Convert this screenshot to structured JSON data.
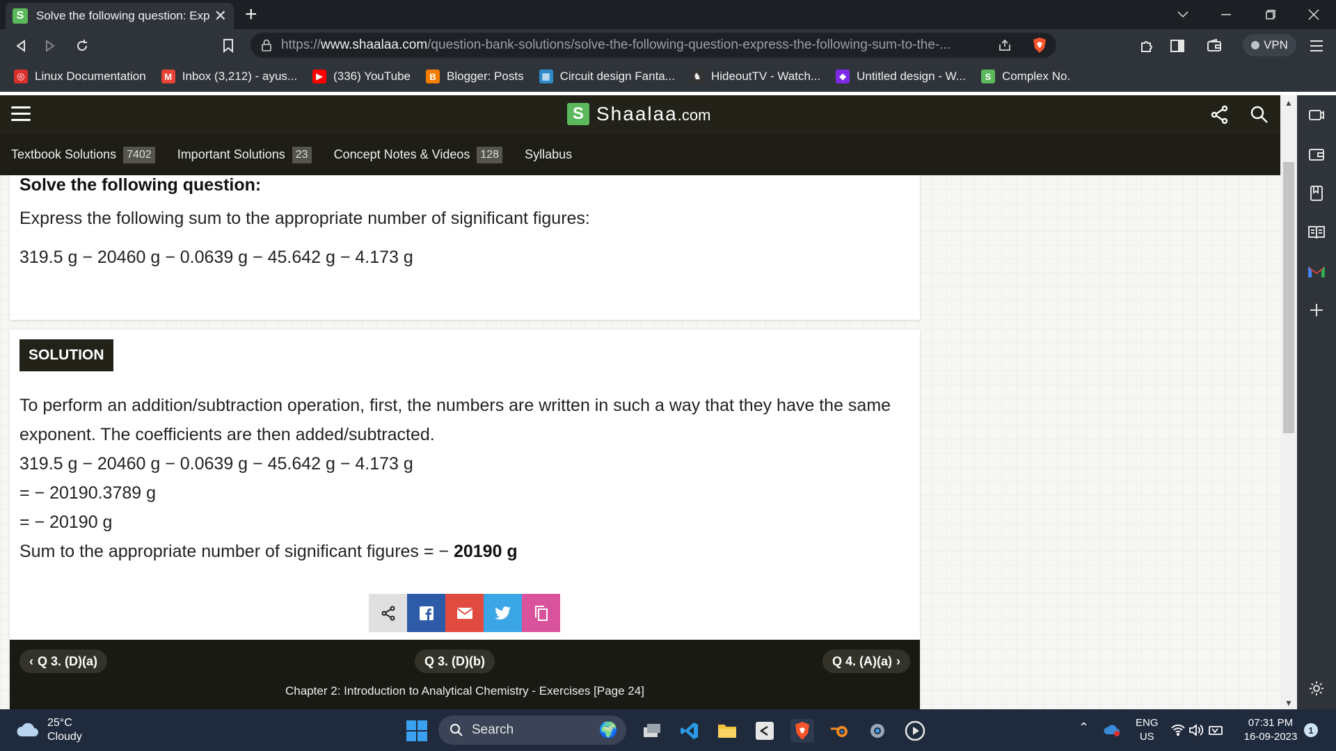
{
  "browser": {
    "tab_title": "Solve the following question: Exp",
    "tab_favicon_letter": "S",
    "url_prefix": "https://",
    "url_host": "www.shaalaa.com",
    "url_path": "/question-bank-solutions/solve-the-following-question-express-the-following-sum-to-the-...",
    "vpn_label": "VPN"
  },
  "bookmarks": [
    {
      "label": "Linux Documentation",
      "icon": "linux-doc-icon",
      "color": "#d9302c"
    },
    {
      "label": "Inbox (3,212) - ayus...",
      "icon": "gmail-icon",
      "color": "#ea4335"
    },
    {
      "label": "(336) YouTube",
      "icon": "youtube-icon",
      "color": "#ff0000"
    },
    {
      "label": "Blogger: Posts",
      "icon": "blogger-icon",
      "color": "#f57d00"
    },
    {
      "label": "Circuit design Fanta...",
      "icon": "tinkercad-icon",
      "color": "#2d89c8"
    },
    {
      "label": "HideoutTV - Watch...",
      "icon": "hideout-icon",
      "color": "#333333"
    },
    {
      "label": "Untitled design - W...",
      "icon": "canva-icon",
      "color": "#7d2ae8"
    },
    {
      "label": "Complex No.",
      "icon": "shaalaa-icon",
      "color": "#5cb85c"
    }
  ],
  "site": {
    "logo_letter": "S",
    "logo_text": "Shaalaa",
    "logo_domain": ".com",
    "subnav": [
      {
        "label": "Textbook Solutions",
        "count": "7402"
      },
      {
        "label": "Important Solutions",
        "count": "23"
      },
      {
        "label": "Concept Notes & Videos",
        "count": "128"
      },
      {
        "label": "Syllabus",
        "count": ""
      }
    ]
  },
  "question": {
    "heading": "Solve the following question:",
    "text": "Express the following sum to the appropriate number of significant figures:",
    "expression": "319.5 g − 20460 g − 0.0639 g − 45.642 g − 4.173 g"
  },
  "solution": {
    "badge": "SOLUTION",
    "intro": "To perform an addition/subtraction operation, first, the numbers are written in such a way that they have the same exponent. The coefficients are then added/subtracted.",
    "line1": "319.5 g − 20460 g − 0.0639 g − 45.642 g − 4.173 g",
    "line2": "= − 20190.3789 g",
    "line3": "= − 20190 g",
    "final_prefix": "Sum to the appropriate number of significant figures = − ",
    "final_value": "20190 g"
  },
  "share": [
    {
      "name": "share-generic-button",
      "icon": "share-icon",
      "color": "#e0e0e0"
    },
    {
      "name": "share-facebook-button",
      "icon": "facebook-icon",
      "color": "#2d5ba8"
    },
    {
      "name": "share-email-button",
      "icon": "email-icon",
      "color": "#e04a3f"
    },
    {
      "name": "share-twitter-button",
      "icon": "twitter-icon",
      "color": "#3aa6e6"
    },
    {
      "name": "share-copy-button",
      "icon": "copy-icon",
      "color": "#d9539c"
    }
  ],
  "question_nav": {
    "prev": "Q 3. (D)(a)",
    "current": "Q 3. (D)(b)",
    "next": "Q 4. (A)(a)",
    "chapter": "Chapter 2: Introduction to Analytical Chemistry - Exercises [Page 24]"
  },
  "taskbar": {
    "temperature": "25°C",
    "condition": "Cloudy",
    "search_label": "Search",
    "lang_primary": "ENG",
    "lang_secondary": "US",
    "time": "07:31 PM",
    "date": "16-09-2023",
    "notification_count": "1"
  }
}
